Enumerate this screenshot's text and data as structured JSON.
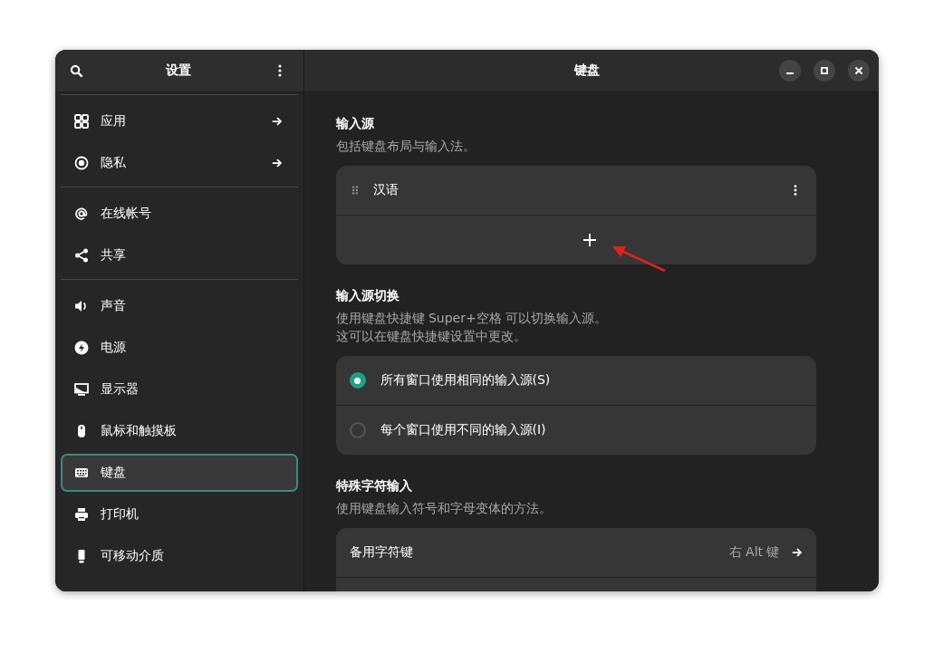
{
  "sidebar": {
    "title": "设置",
    "groups": [
      [
        {
          "label": "应用",
          "opens_page": true,
          "selected": false
        },
        {
          "label": "隐私",
          "opens_page": true,
          "selected": false
        }
      ],
      [
        {
          "label": "在线帐号",
          "opens_page": false,
          "selected": false
        },
        {
          "label": "共享",
          "opens_page": false,
          "selected": false
        }
      ],
      [
        {
          "label": "声音",
          "opens_page": false,
          "selected": false
        },
        {
          "label": "电源",
          "opens_page": false,
          "selected": false
        },
        {
          "label": "显示器",
          "opens_page": false,
          "selected": false
        },
        {
          "label": "鼠标和触摸板",
          "opens_page": false,
          "selected": false
        },
        {
          "label": "键盘",
          "opens_page": false,
          "selected": true
        },
        {
          "label": "打印机",
          "opens_page": false,
          "selected": false
        },
        {
          "label": "可移动介质",
          "opens_page": false,
          "selected": false
        }
      ]
    ]
  },
  "page": {
    "title": "键盘",
    "sections": [
      {
        "title": "输入源",
        "subtitle": "包括键盘布局与输入法。",
        "rows": [
          {
            "kind": "source",
            "label": "汉语"
          },
          {
            "kind": "add"
          }
        ]
      },
      {
        "title": "输入源切换",
        "subtitle_lines": [
          "使用键盘快捷键 Super+空格 可以切换输入源。",
          "这可以在键盘快捷键设置中更改。"
        ],
        "rows": [
          {
            "kind": "radio",
            "label": "所有窗口使用相同的输入源(S)",
            "selected": true
          },
          {
            "kind": "radio",
            "label": "每个窗口使用不同的输入源(I)",
            "selected": false
          }
        ]
      },
      {
        "title": "特殊字符输入",
        "subtitle": "使用键盘输入符号和字母变体的方法。",
        "rows": [
          {
            "kind": "link",
            "label": "备用字符键",
            "value": "右 Alt 键"
          },
          {
            "kind": "blank"
          }
        ]
      }
    ]
  }
}
